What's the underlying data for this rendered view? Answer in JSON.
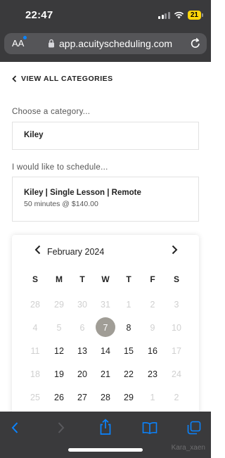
{
  "status_bar": {
    "time": "22:47",
    "battery": "21",
    "icons": [
      "cellular-signal-icon",
      "wifi-icon",
      "battery-icon"
    ]
  },
  "browser": {
    "aa_label": "AA",
    "url": "app.acuityscheduling.com",
    "icons": [
      "lock-icon",
      "reload-icon"
    ]
  },
  "page": {
    "back_link": "VIEW ALL CATEGORIES",
    "category_label": "Choose a category...",
    "category_value": "Kiley",
    "schedule_label": "I would like to schedule...",
    "appointment_name": "Kiley | Single Lesson | Remote",
    "appointment_detail": "50 minutes @ $140.00"
  },
  "calendar": {
    "month_label": "February 2024",
    "weekdays": [
      "S",
      "M",
      "T",
      "W",
      "T",
      "F",
      "S"
    ],
    "weeks": [
      [
        "28",
        "29",
        "30",
        "31",
        "1",
        "2",
        "3"
      ],
      [
        "4",
        "5",
        "6",
        "7",
        "8",
        "9",
        "10"
      ],
      [
        "11",
        "12",
        "13",
        "14",
        "15",
        "16",
        "17"
      ],
      [
        "18",
        "19",
        "20",
        "21",
        "22",
        "23",
        "24"
      ],
      [
        "25",
        "26",
        "27",
        "28",
        "29",
        "1",
        "2"
      ]
    ],
    "available": [
      "7",
      "8",
      "12",
      "13",
      "14",
      "15",
      "16",
      "19",
      "20",
      "21",
      "22",
      "23",
      "26",
      "27",
      "28",
      "29"
    ],
    "selected": "7",
    "selected_color": "#a09d96"
  },
  "toolbar": {
    "icons": [
      "back-arrow-icon",
      "forward-arrow-icon",
      "share-icon",
      "bookmarks-icon",
      "tabs-icon"
    ],
    "watermark": "Kara_xaen"
  }
}
